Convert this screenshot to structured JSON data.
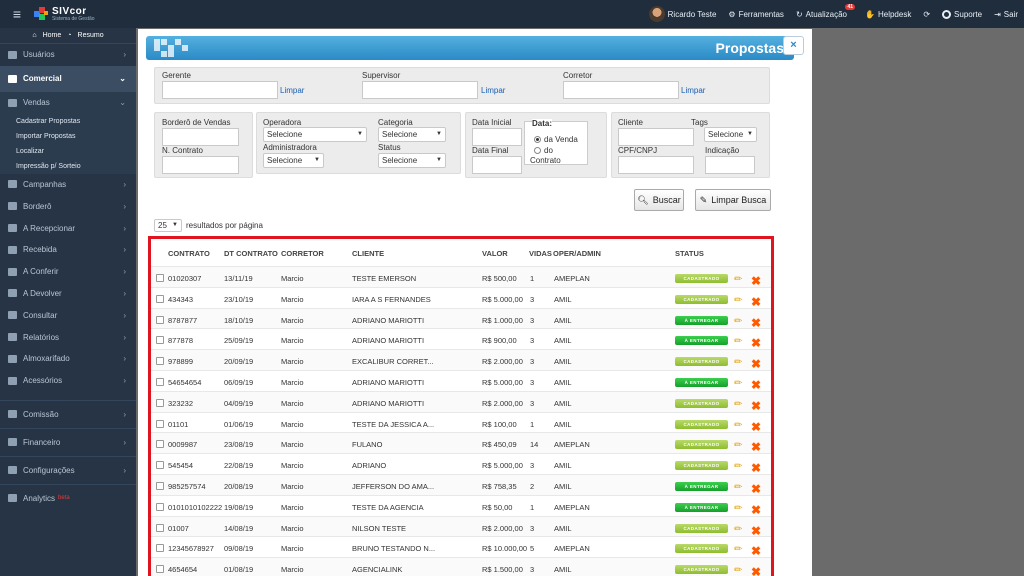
{
  "topbar": {
    "menu_icon": "hamburger-icon",
    "brand": "SIVcor",
    "brand_sub": "Sistema de Gestão",
    "user": "Ricardo Teste",
    "ferramentas": "Ferramentas",
    "atualizacao": "Atualização",
    "atualizacao_badge": "41",
    "helpdesk": "Helpdesk",
    "suporte": "Suporte",
    "sair": "Sair"
  },
  "sidebar": {
    "home": "Home",
    "resumo": "Resumo",
    "items": [
      {
        "label": "Usuários"
      },
      {
        "label": "Comercial",
        "active": true
      },
      {
        "label": "Vendas"
      },
      {
        "label": "Campanhas"
      },
      {
        "label": "Borderô"
      },
      {
        "label": "A Recepcionar"
      },
      {
        "label": "Recebida"
      },
      {
        "label": "A Conferir"
      },
      {
        "label": "A Devolver"
      },
      {
        "label": "Consultar"
      },
      {
        "label": "Relatórios"
      },
      {
        "label": "Almoxarifado"
      },
      {
        "label": "Acessórios"
      },
      {
        "label": "Comissão"
      },
      {
        "label": "Financeiro"
      },
      {
        "label": "Configurações"
      },
      {
        "label": "Analytics",
        "badge": "beta"
      }
    ],
    "vendas_sub": [
      "Cadastrar Propostas",
      "Importar Propostas",
      "Localizar",
      "Impressão p/ Sorteio"
    ]
  },
  "modal": {
    "title": "Propostas",
    "close": "×",
    "filters": {
      "gerente": "Gerente",
      "supervisor": "Supervisor",
      "corretor": "Corretor",
      "limpar": "Limpar",
      "bordero": "Borderô de Vendas",
      "n_contrato": "N. Contrato",
      "operadora": "Operadora",
      "administradora": "Administradora",
      "categoria": "Categoria",
      "status": "Status",
      "selecione": "Selecione",
      "data_inicial": "Data Inicial",
      "data_final": "Data Final",
      "data": "Data:",
      "da_venda": "da Venda",
      "do": "do",
      "contrato": "Contrato",
      "cliente": "Cliente",
      "tags": "Tags",
      "cpf": "CPF/CNPJ",
      "indicacao": "Indicação"
    },
    "buscar": "Buscar",
    "limpar_busca": "Limpar Busca",
    "per_page_value": "25",
    "per_page_label": "resultados por página"
  },
  "table": {
    "headers": [
      "CONTRATO",
      "DT CONTRATO",
      "CORRETOR",
      "CLIENTE",
      "VALOR",
      "VIDAS",
      "OPER/ADMIN",
      "STATUS"
    ],
    "status_labels": {
      "cad": "CADASTRADO",
      "ent": "À ENTREGAR"
    },
    "rows": [
      {
        "contrato": "01020307",
        "dt": "13/11/19",
        "corretor": "Marcio",
        "cliente": "TESTE EMERSON",
        "valor": "R$ 500,00",
        "vidas": "1",
        "oper": "AMEPLAN",
        "status": "cad"
      },
      {
        "contrato": "434343",
        "dt": "23/10/19",
        "corretor": "Marcio",
        "cliente": "IARA A S FERNANDES",
        "valor": "R$ 5.000,00",
        "vidas": "3",
        "oper": "AMIL",
        "status": "cad"
      },
      {
        "contrato": "8787877",
        "dt": "18/10/19",
        "corretor": "Marcio",
        "cliente": "ADRIANO MARIOTTI",
        "valor": "R$ 1.000,00",
        "vidas": "3",
        "oper": "AMIL",
        "status": "ent"
      },
      {
        "contrato": "877878",
        "dt": "25/09/19",
        "corretor": "Marcio",
        "cliente": "ADRIANO MARIOTTI",
        "valor": "R$ 900,00",
        "vidas": "3",
        "oper": "AMIL",
        "status": "ent"
      },
      {
        "contrato": "978899",
        "dt": "20/09/19",
        "corretor": "Marcio",
        "cliente": "EXCALIBUR CORRET...",
        "valor": "R$ 2.000,00",
        "vidas": "3",
        "oper": "AMIL",
        "status": "cad"
      },
      {
        "contrato": "54654654",
        "dt": "06/09/19",
        "corretor": "Marcio",
        "cliente": "ADRIANO MARIOTTI",
        "valor": "R$ 5.000,00",
        "vidas": "3",
        "oper": "AMIL",
        "status": "ent"
      },
      {
        "contrato": "323232",
        "dt": "04/09/19",
        "corretor": "Marcio",
        "cliente": "ADRIANO MARIOTTI",
        "valor": "R$ 2.000,00",
        "vidas": "3",
        "oper": "AMIL",
        "status": "cad"
      },
      {
        "contrato": "01101",
        "dt": "01/06/19",
        "corretor": "Marcio",
        "cliente": "TESTE DA JESSICA A...",
        "valor": "R$ 100,00",
        "vidas": "1",
        "oper": "AMIL",
        "status": "cad"
      },
      {
        "contrato": "0009987",
        "dt": "23/08/19",
        "corretor": "Marcio",
        "cliente": "FULANO",
        "valor": "R$ 450,09",
        "vidas": "14",
        "oper": "AMEPLAN",
        "status": "cad"
      },
      {
        "contrato": "545454",
        "dt": "22/08/19",
        "corretor": "Marcio",
        "cliente": "ADRIANO",
        "valor": "R$ 5.000,00",
        "vidas": "3",
        "oper": "AMIL",
        "status": "cad"
      },
      {
        "contrato": "985257574",
        "dt": "20/08/19",
        "corretor": "Marcio",
        "cliente": "JEFFERSON DO AMA...",
        "valor": "R$ 758,35",
        "vidas": "2",
        "oper": "AMIL",
        "status": "ent"
      },
      {
        "contrato": "0101010102222",
        "dt": "19/08/19",
        "corretor": "Marcio",
        "cliente": "TESTE DA AGENCIA",
        "valor": "R$ 50,00",
        "vidas": "1",
        "oper": "AMEPLAN",
        "status": "ent"
      },
      {
        "contrato": "01007",
        "dt": "14/08/19",
        "corretor": "Marcio",
        "cliente": "NILSON TESTE",
        "valor": "R$ 2.000,00",
        "vidas": "3",
        "oper": "AMIL",
        "status": "cad"
      },
      {
        "contrato": "12345678927",
        "dt": "09/08/19",
        "corretor": "Marcio",
        "cliente": "BRUNO TESTANDO N...",
        "valor": "R$ 10.000,00",
        "vidas": "5",
        "oper": "AMEPLAN",
        "status": "cad"
      },
      {
        "contrato": "4654654",
        "dt": "01/08/19",
        "corretor": "Marcio",
        "cliente": "AGENCIALINK",
        "valor": "R$ 1.500,00",
        "vidas": "3",
        "oper": "AMIL",
        "status": "cad"
      }
    ]
  },
  "colors": {
    "accent": "#2b8ac6",
    "highlight": "#e0141e",
    "cadastrado": "#9fc840",
    "entregar": "#22b038"
  }
}
